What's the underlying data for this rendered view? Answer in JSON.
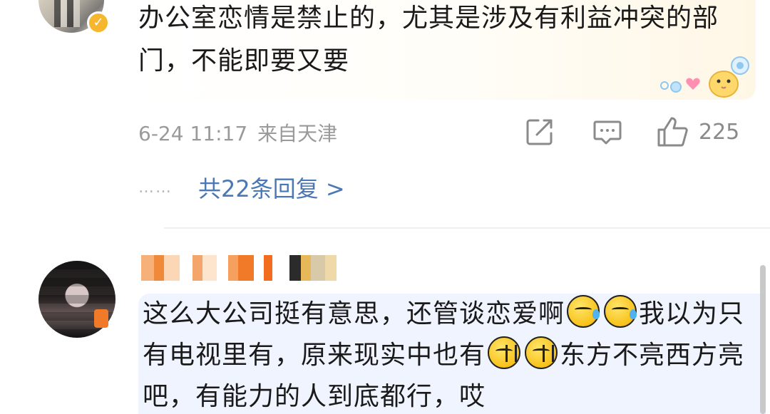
{
  "comment1": {
    "text": "办公室恋情是禁止的，尤其是涉及有利益冲突的部门，不能即要又要",
    "date": "6-24 11:17",
    "location": "来自天津",
    "like_count": "225",
    "replies_dots": "……",
    "replies_link": "共22条回复 >"
  },
  "comment2": {
    "text_part1": "这么大公司挺有意思，还管谈恋爱啊",
    "text_part2": "我以为只有电视里有，原来现实中也有",
    "text_part3": "东方不亮西方亮吧，有能力的人到底都行，哎"
  },
  "colors": {
    "link": "#4a77b6",
    "meta": "#9a9a9a",
    "bubble2": "#f0f4ff",
    "badge": "#f6b62d"
  },
  "icons": {
    "share": "share-icon",
    "reply": "comment-icon",
    "like": "thumbs-up-icon",
    "emoji_sweat": "sweat-smile-emoji",
    "emoji_wave": "awkward-emoji"
  }
}
